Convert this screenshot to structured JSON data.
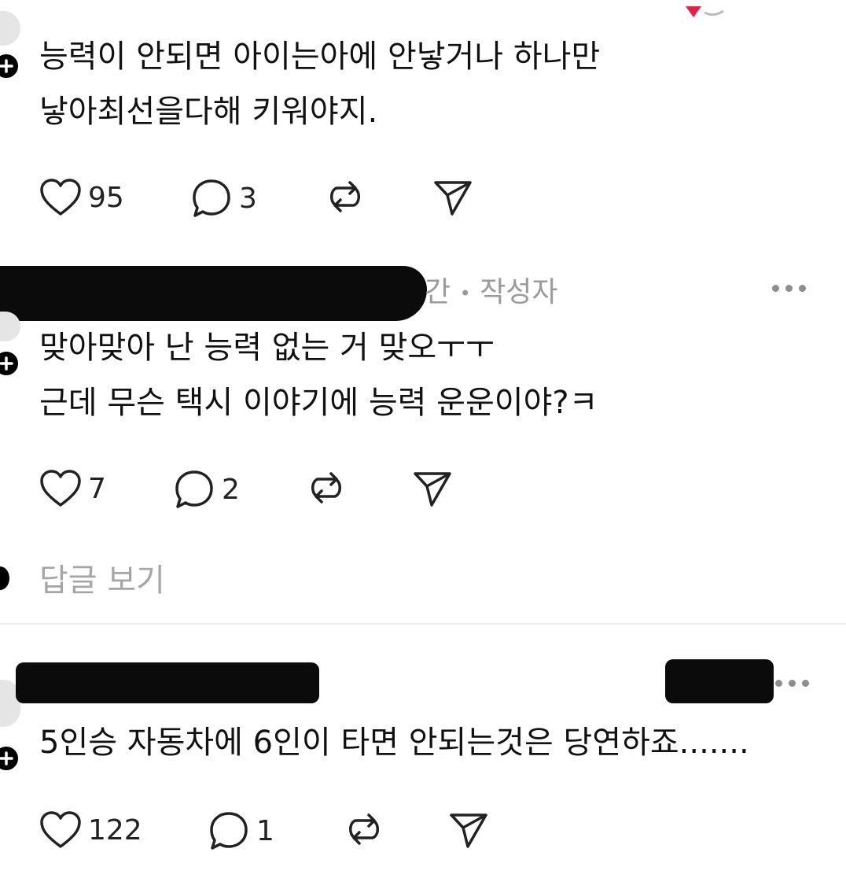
{
  "posts": [
    {
      "lines": [
        "능력이  안되면 아이는아에 안낳거나 하나만",
        "낳아최선을다해 키워야지."
      ],
      "likes": "95",
      "replies": "3"
    },
    {
      "meta_time_suffix": "간",
      "meta_bullet": "•",
      "meta_author": "작성자",
      "lines": [
        "맞아맞아 난 능력 없는 거 맞오ㅜㅜ",
        "근데 무슨 택시 이야기에 능력 운운이야?ㅋ"
      ],
      "likes": "7",
      "replies": "2",
      "view_replies": "답글 보기"
    },
    {
      "lines": [
        "5인승 자동차에 6인이 타면 안되는것은 당연하죠......."
      ],
      "likes": "122",
      "replies": "1"
    }
  ],
  "icons": {
    "like": "heart-icon",
    "reply": "comment-icon",
    "repost": "repost-icon",
    "share": "send-icon",
    "follow": "plus-icon",
    "more": "more-icon"
  },
  "colors": {
    "text": "#111111",
    "meta": "#9a9a9a",
    "like_heart_accent": "#e0224a"
  }
}
